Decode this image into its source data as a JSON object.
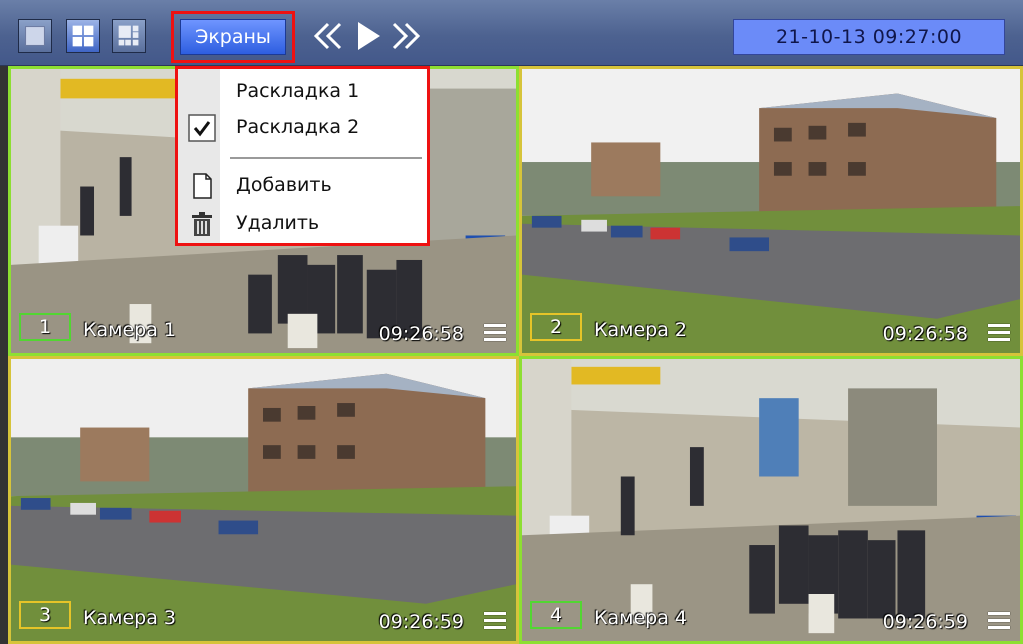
{
  "toolbar": {
    "layouts": [
      {
        "name": "single-view",
        "active": false
      },
      {
        "name": "quad-view",
        "active": true
      },
      {
        "name": "multi-view",
        "active": false
      }
    ],
    "screens_label": "Экраны",
    "datetime": "21-10-13   09:27:00"
  },
  "menu": {
    "items": [
      {
        "label": "Раскладка 1",
        "checked": false,
        "icon": ""
      },
      {
        "label": "Раскладка 2",
        "checked": true,
        "icon": "check-icon"
      },
      {
        "label": "Добавить",
        "checked": false,
        "icon": "document-icon"
      },
      {
        "label": "Удалить",
        "checked": false,
        "icon": "trash-icon"
      }
    ]
  },
  "cameras": [
    {
      "number": "1",
      "name": "Камера 1",
      "time": "09:26:58",
      "border": "#8ddf32",
      "number_border": "#52d632"
    },
    {
      "number": "2",
      "name": "Камера 2",
      "time": "09:26:58",
      "border": "#d6c43a",
      "number_border": "#e6c428"
    },
    {
      "number": "3",
      "name": "Камера 3",
      "time": "09:26:59",
      "border": "#d6c43a",
      "number_border": "#e6c428"
    },
    {
      "number": "4",
      "name": "Камера 4",
      "time": "09:26:59",
      "border": "#8ddf32",
      "number_border": "#52d632"
    }
  ],
  "colors": {
    "toolbar": "#4d6290",
    "accent_button": "#2d5ee0",
    "datetime_bg": "#6b8bf8",
    "highlight": "#e11111"
  }
}
